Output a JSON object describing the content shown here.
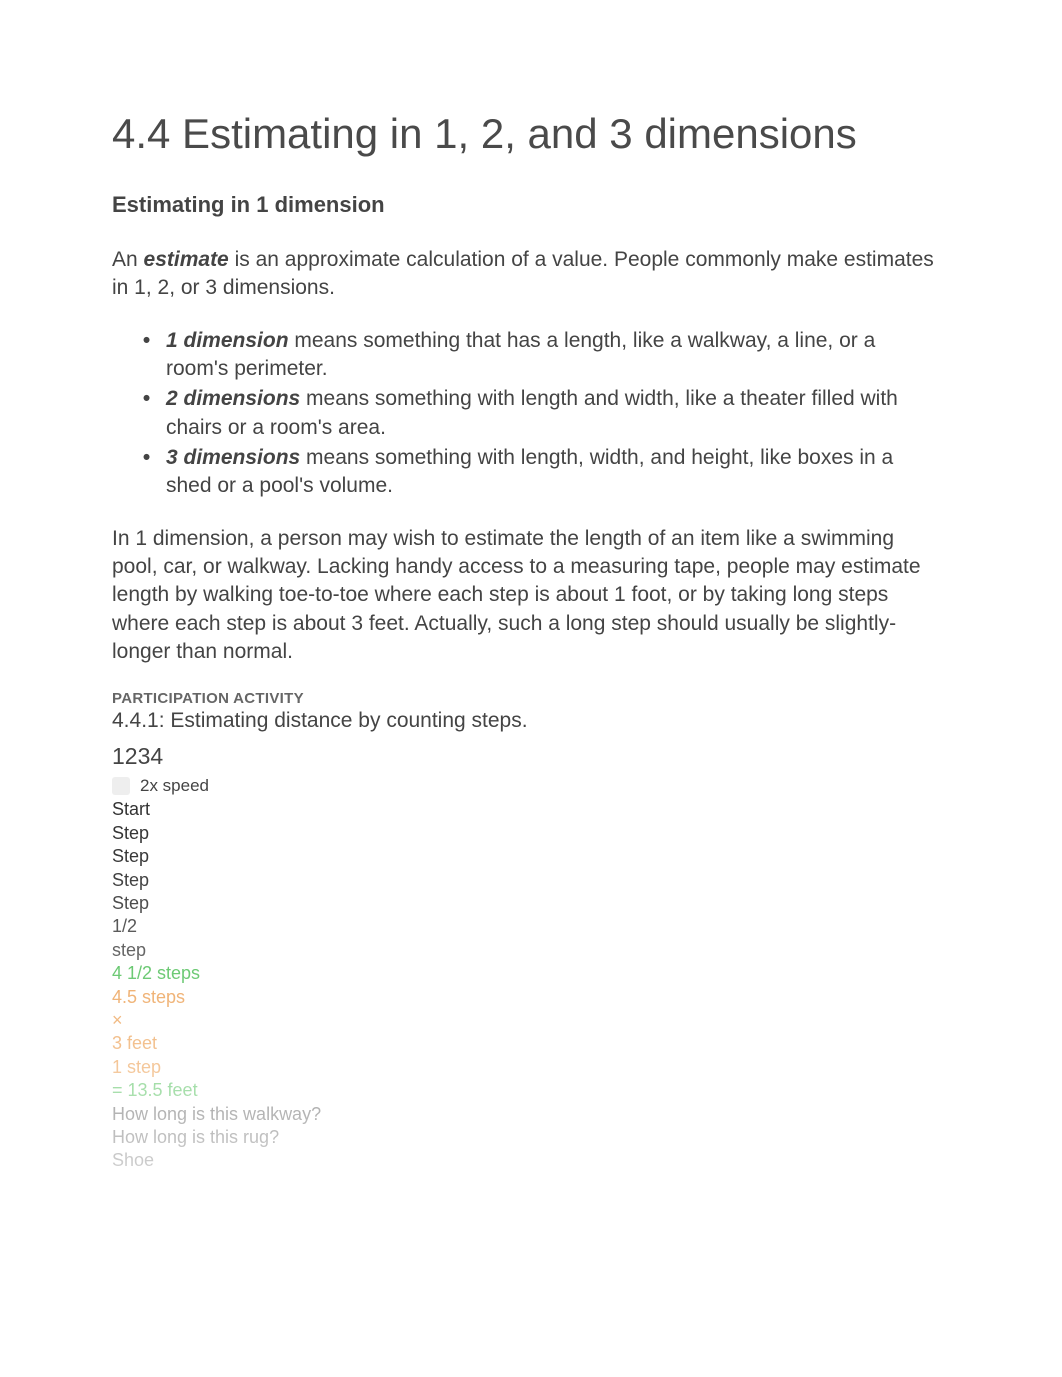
{
  "title": "4.4 Estimating in 1, 2, and 3 dimensions",
  "subheading": "Estimating in 1 dimension",
  "intro": {
    "before": "An ",
    "term": "estimate",
    "after": " is an approximate calculation of a value. People commonly make estimates in 1, 2, or 3 dimensions."
  },
  "bullets": [
    {
      "term": "1 dimension",
      "after": " means something that has a length, like a walkway, a line, or a room's perimeter."
    },
    {
      "term": "2 dimensions",
      "after": " means something with length and width, like a theater filled with chairs or a room's area."
    },
    {
      "term": "3 dimensions",
      "after": " means something with length, width, and height, like boxes in a shed or a pool's volume."
    }
  ],
  "paragraph2": "In 1 dimension, a person may wish to estimate the length of an item like a swimming pool, car, or walkway. Lacking handy access to a measuring tape, people may estimate length by walking toe-to-toe where each step is about 1 foot, or by taking long steps where each step is about 3 feet. Actually, such a long step should usually be slightly-longer than normal.",
  "activity": {
    "label": "PARTICIPATION ACTIVITY",
    "title": "4.4.1: Estimating distance by counting steps.",
    "nums": "1234",
    "speed": "2x speed",
    "lines": {
      "start": "Start",
      "step1": "Step",
      "step2": "Step",
      "step3": "Step",
      "step4": "Step",
      "half1": "1/2",
      "half2": "step",
      "greenTotal": "4 1/2 steps",
      "orange1": "4.5 steps",
      "orange2": "×",
      "orange3": "3 feet",
      "orange4": "1 step",
      "greenResult": "= 13.5 feet",
      "q1": "How long is this walkway?",
      "q2": "How long is this rug?",
      "shoe": "Shoe"
    }
  }
}
